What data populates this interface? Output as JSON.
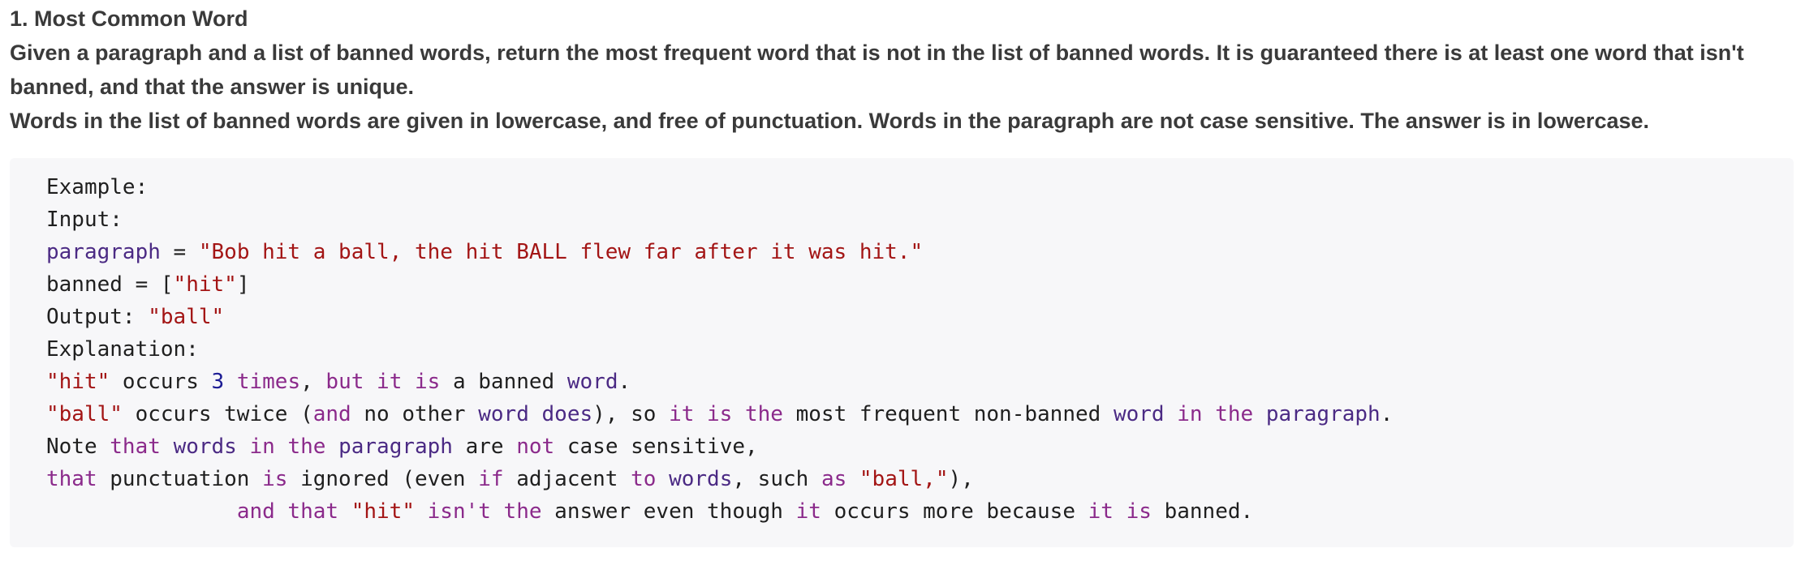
{
  "problem": {
    "title": "1. Most Common Word",
    "description": [
      "Given a paragraph and a list of banned words, return the most frequent word that is not in the list of banned words. It is guaranteed there is at least one word that isn't banned, and that the answer is unique.",
      "Words in the list of banned words are given in lowercase, and free of punctuation. Words in the paragraph are not case sensitive. The answer is in lowercase."
    ]
  },
  "colors": {
    "string": "#a31515",
    "keyword": "#8b2a8b",
    "variable": "#4b2a84",
    "number": "#1c1c94",
    "plain": "#1f1f1f",
    "code_background": "#f7f7f9"
  },
  "code": {
    "lines": [
      [
        {
          "t": "Example:",
          "k": "txt"
        }
      ],
      [
        {
          "t": "Input:",
          "k": "txt"
        }
      ],
      [
        {
          "t": "paragraph",
          "k": "var"
        },
        {
          "t": " = ",
          "k": "txt"
        },
        {
          "t": "\"Bob hit a ball, the hit BALL flew far after it was hit.\"",
          "k": "str"
        }
      ],
      [
        {
          "t": "banned = [",
          "k": "txt"
        },
        {
          "t": "\"hit\"",
          "k": "str"
        },
        {
          "t": "]",
          "k": "txt"
        }
      ],
      [
        {
          "t": "Output: ",
          "k": "txt"
        },
        {
          "t": "\"ball\"",
          "k": "str"
        }
      ],
      [
        {
          "t": "Explanation:",
          "k": "txt"
        }
      ],
      [
        {
          "t": "\"hit\"",
          "k": "str"
        },
        {
          "t": " occurs ",
          "k": "txt"
        },
        {
          "t": "3",
          "k": "num"
        },
        {
          "t": " ",
          "k": "txt"
        },
        {
          "t": "times",
          "k": "kw"
        },
        {
          "t": ", ",
          "k": "txt"
        },
        {
          "t": "but it is",
          "k": "kw"
        },
        {
          "t": " a banned ",
          "k": "txt"
        },
        {
          "t": "word",
          "k": "var"
        },
        {
          "t": ".",
          "k": "txt"
        }
      ],
      [
        {
          "t": "\"ball\"",
          "k": "str"
        },
        {
          "t": " occurs twice (",
          "k": "txt"
        },
        {
          "t": "and",
          "k": "kw"
        },
        {
          "t": " no other ",
          "k": "txt"
        },
        {
          "t": "word does",
          "k": "var"
        },
        {
          "t": "), so ",
          "k": "txt"
        },
        {
          "t": "it is the",
          "k": "kw"
        },
        {
          "t": " most frequent non-banned ",
          "k": "txt"
        },
        {
          "t": "word",
          "k": "var"
        },
        {
          "t": " ",
          "k": "txt"
        },
        {
          "t": "in the",
          "k": "kw"
        },
        {
          "t": " ",
          "k": "txt"
        },
        {
          "t": "paragraph",
          "k": "var"
        },
        {
          "t": ".",
          "k": "txt"
        }
      ],
      [
        {
          "t": "Note ",
          "k": "txt"
        },
        {
          "t": "that",
          "k": "kw"
        },
        {
          "t": " ",
          "k": "txt"
        },
        {
          "t": "words",
          "k": "var"
        },
        {
          "t": " ",
          "k": "txt"
        },
        {
          "t": "in the",
          "k": "kw"
        },
        {
          "t": " ",
          "k": "txt"
        },
        {
          "t": "paragraph",
          "k": "var"
        },
        {
          "t": " are ",
          "k": "txt"
        },
        {
          "t": "not",
          "k": "kw"
        },
        {
          "t": " case sensitive,",
          "k": "txt"
        }
      ],
      [
        {
          "t": "that",
          "k": "kw"
        },
        {
          "t": " punctuation ",
          "k": "txt"
        },
        {
          "t": "is",
          "k": "kw"
        },
        {
          "t": " ignored (even ",
          "k": "txt"
        },
        {
          "t": "if",
          "k": "kw"
        },
        {
          "t": " adjacent ",
          "k": "txt"
        },
        {
          "t": "to",
          "k": "kw"
        },
        {
          "t": " ",
          "k": "txt"
        },
        {
          "t": "words",
          "k": "var"
        },
        {
          "t": ", such ",
          "k": "txt"
        },
        {
          "t": "as",
          "k": "kw"
        },
        {
          "t": " ",
          "k": "txt"
        },
        {
          "t": "\"ball,\"",
          "k": "str"
        },
        {
          "t": "),",
          "k": "txt"
        }
      ],
      [
        {
          "t": "               ",
          "k": "txt"
        },
        {
          "t": "and that",
          "k": "kw"
        },
        {
          "t": " ",
          "k": "txt"
        },
        {
          "t": "\"hit\"",
          "k": "str"
        },
        {
          "t": " ",
          "k": "txt"
        },
        {
          "t": "isn't the",
          "k": "kw"
        },
        {
          "t": " answer even though ",
          "k": "txt"
        },
        {
          "t": "it",
          "k": "kw"
        },
        {
          "t": " occurs more because ",
          "k": "txt"
        },
        {
          "t": "it is",
          "k": "kw"
        },
        {
          "t": " banned.",
          "k": "txt"
        }
      ]
    ]
  }
}
